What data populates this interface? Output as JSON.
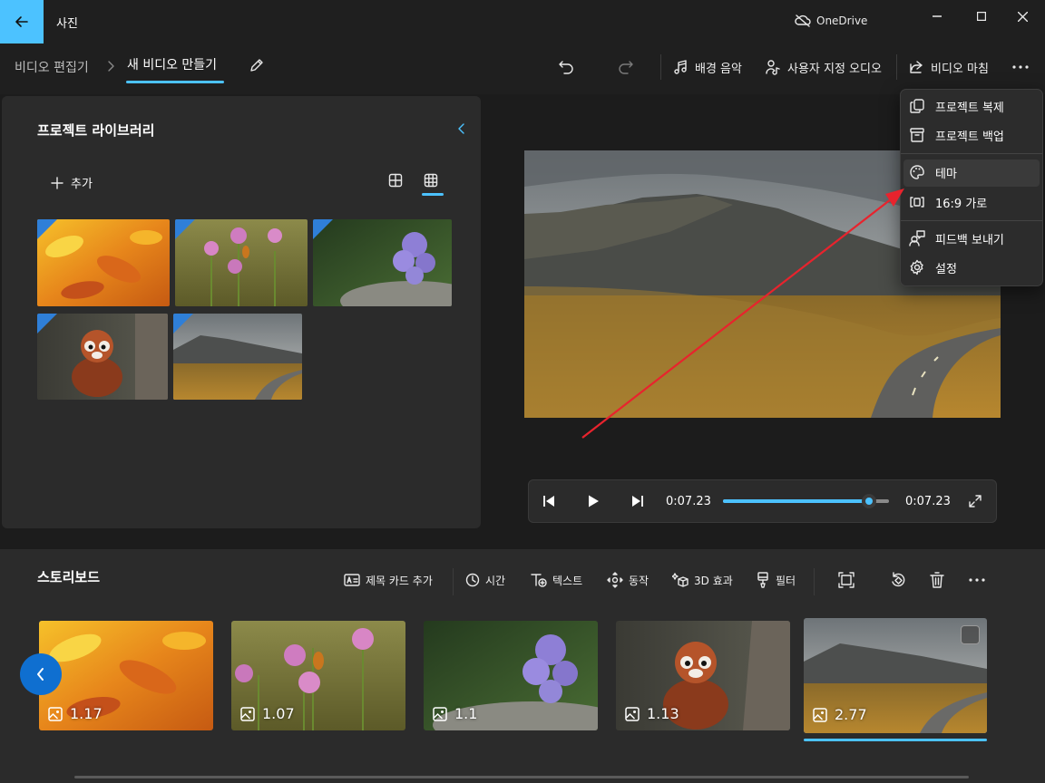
{
  "app": {
    "title": "사진",
    "onedrive": "OneDrive"
  },
  "breadcrumb": {
    "editor": "비디오 편집기",
    "current": "새 비디오 만들기"
  },
  "toolbar": {
    "background_music": "배경 음악",
    "custom_audio": "사용자 지정 오디오",
    "finish_video": "비디오 마침"
  },
  "library": {
    "title": "프로젝트 라이브러리",
    "add_label": "추가"
  },
  "player": {
    "current_time": "0:07.23",
    "total_time": "0:07.23",
    "progress": 0.88
  },
  "storyboard": {
    "title": "스토리보드",
    "tools": {
      "title_card": "제목 카드 추가",
      "duration": "시간",
      "text": "텍스트",
      "motion": "동작",
      "effects_3d": "3D 효과",
      "filters": "필터"
    },
    "clips": [
      {
        "duration": "1.17"
      },
      {
        "duration": "1.07"
      },
      {
        "duration": "1.1"
      },
      {
        "duration": "1.13"
      },
      {
        "duration": "2.77"
      }
    ]
  },
  "menu": {
    "items": [
      {
        "label": "프로젝트 복제"
      },
      {
        "label": "프로젝트 백업"
      },
      {
        "label": "테마"
      },
      {
        "label": "16:9 가로"
      },
      {
        "label": "피드백 보내기"
      },
      {
        "label": "설정"
      }
    ]
  },
  "colors": {
    "accent": "#4cc2ff",
    "arrow": "#e8232d",
    "panel": "#2b2b2b"
  }
}
